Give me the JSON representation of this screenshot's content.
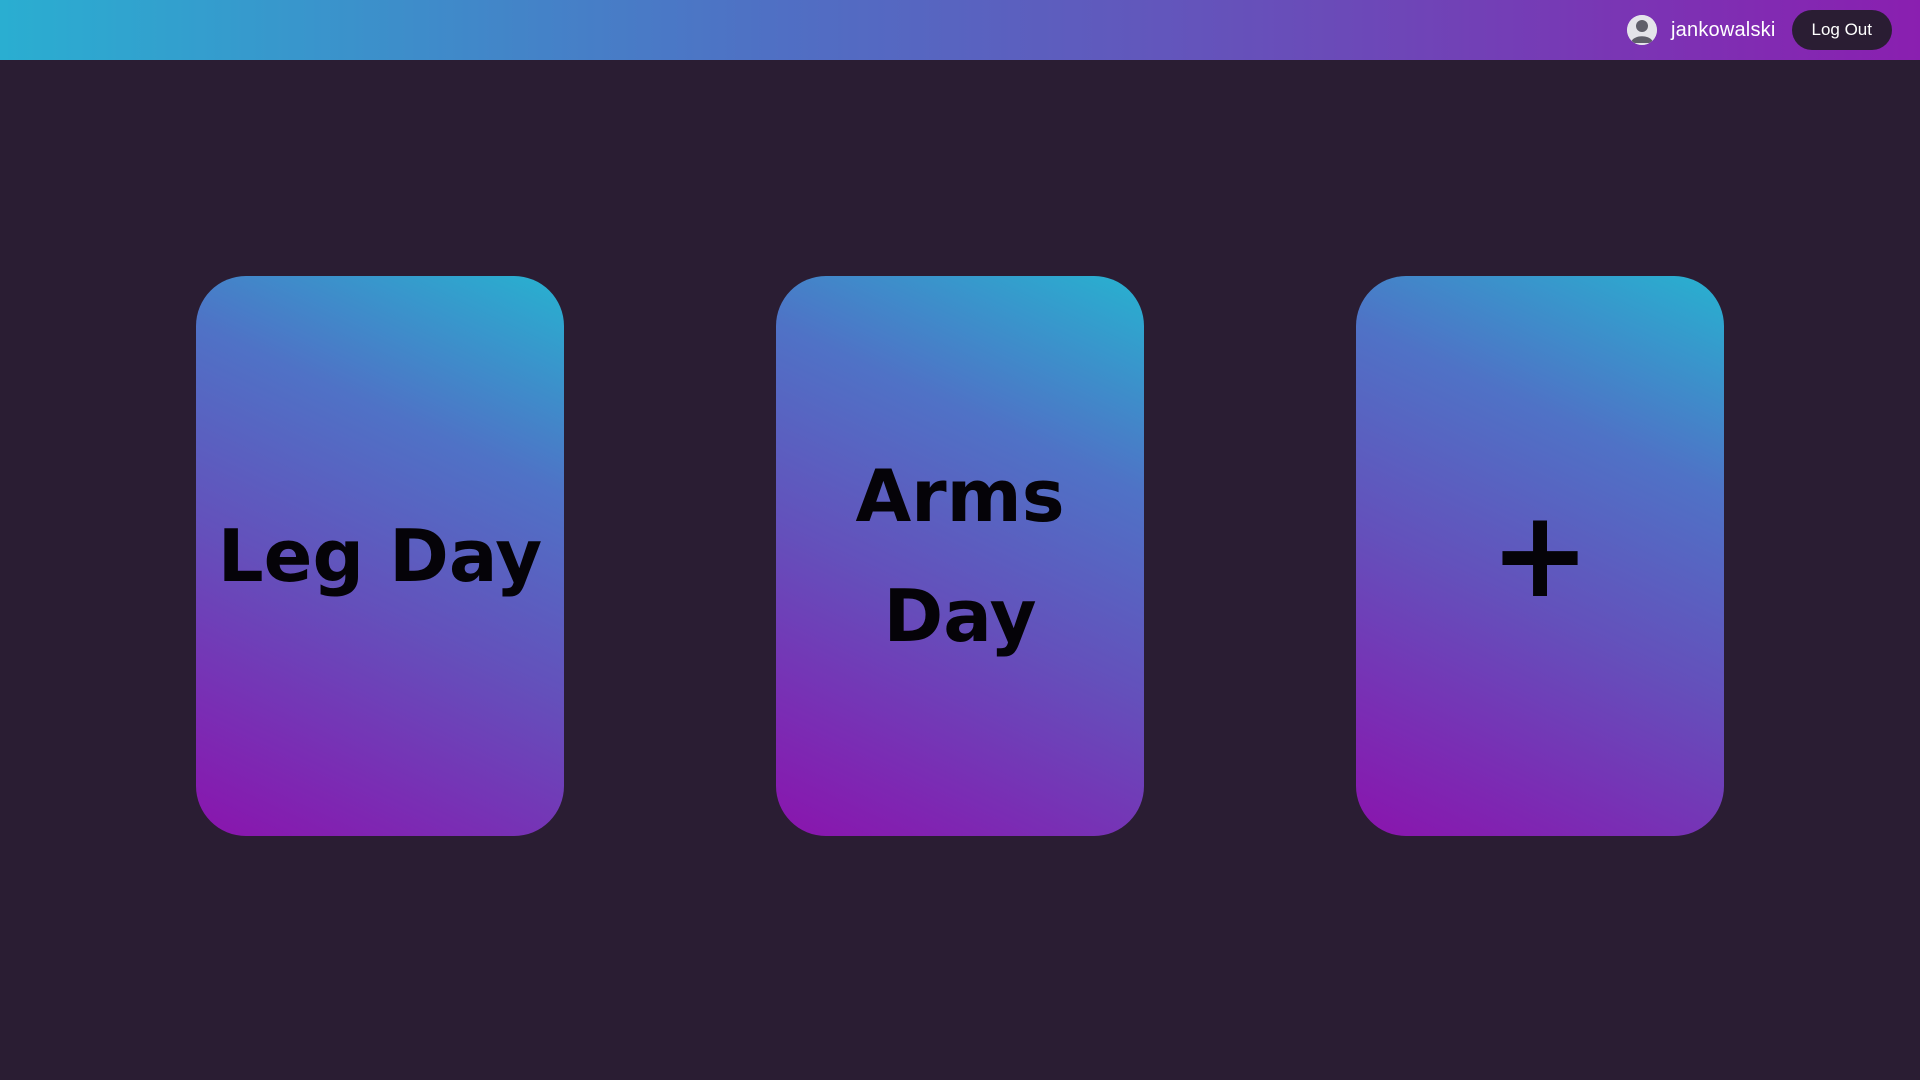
{
  "header": {
    "username": "jankowalski",
    "logout_label": "Log Out"
  },
  "cards": [
    {
      "title": "Leg Day"
    },
    {
      "title": "Arms Day"
    },
    {
      "title": "+"
    }
  ],
  "colors": {
    "background": "#2a1d33",
    "gradient_start": "#2aaed1",
    "gradient_end": "#8a1fb0",
    "card_text": "#050308"
  },
  "icons": {
    "avatar": "user-avatar-icon",
    "add": "plus-icon"
  }
}
